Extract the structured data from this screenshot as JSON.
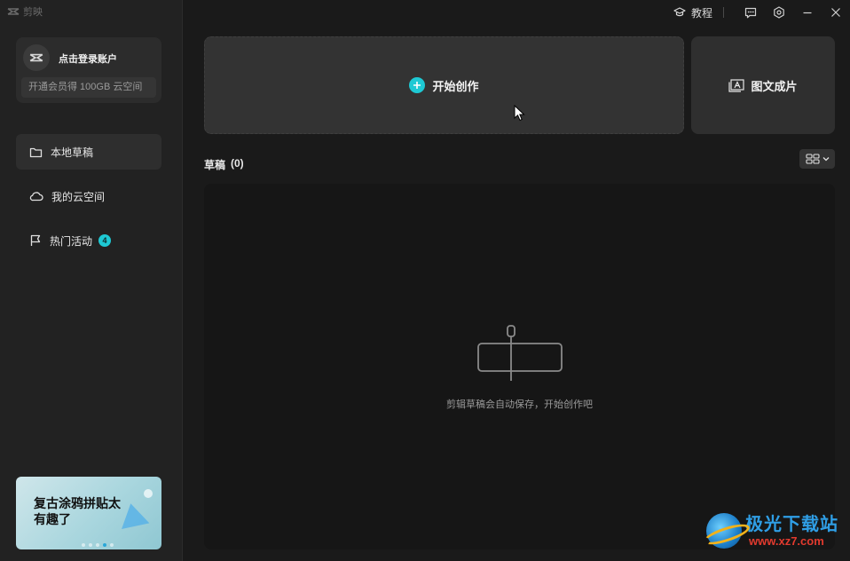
{
  "app": {
    "name": "剪映"
  },
  "titlebar": {
    "tutorial_label": "教程",
    "icons": [
      "graduation-cap-icon",
      "feedback-icon",
      "settings-icon",
      "minimize-icon",
      "close-icon"
    ]
  },
  "account": {
    "login_label": "点击登录账户",
    "vip_promo": "开通会员得 100GB 云空间"
  },
  "sidebar": {
    "items": [
      {
        "label": "本地草稿",
        "icon": "folder-icon",
        "active": true
      },
      {
        "label": "我的云空间",
        "icon": "cloud-icon",
        "active": false
      },
      {
        "label": "热门活动",
        "icon": "flag-icon",
        "active": false,
        "badge": "4"
      }
    ]
  },
  "banner": {
    "text": "复古涂鸦拼贴太有趣了",
    "dot_count": 5,
    "active_dot": 4
  },
  "actions": {
    "create_label": "开始创作",
    "image_to_video_label": "图文成片"
  },
  "drafts": {
    "title": "草稿",
    "count": "(0)",
    "empty_message": "剪辑草稿会自动保存，开始创作吧"
  },
  "watermark": {
    "site_name": "极光下载站",
    "url": "www.xz7.com"
  },
  "colors": {
    "accent": "#1ec9d4",
    "background": "#1a1a1a",
    "sidebar": "#222222",
    "card": "#333333"
  }
}
